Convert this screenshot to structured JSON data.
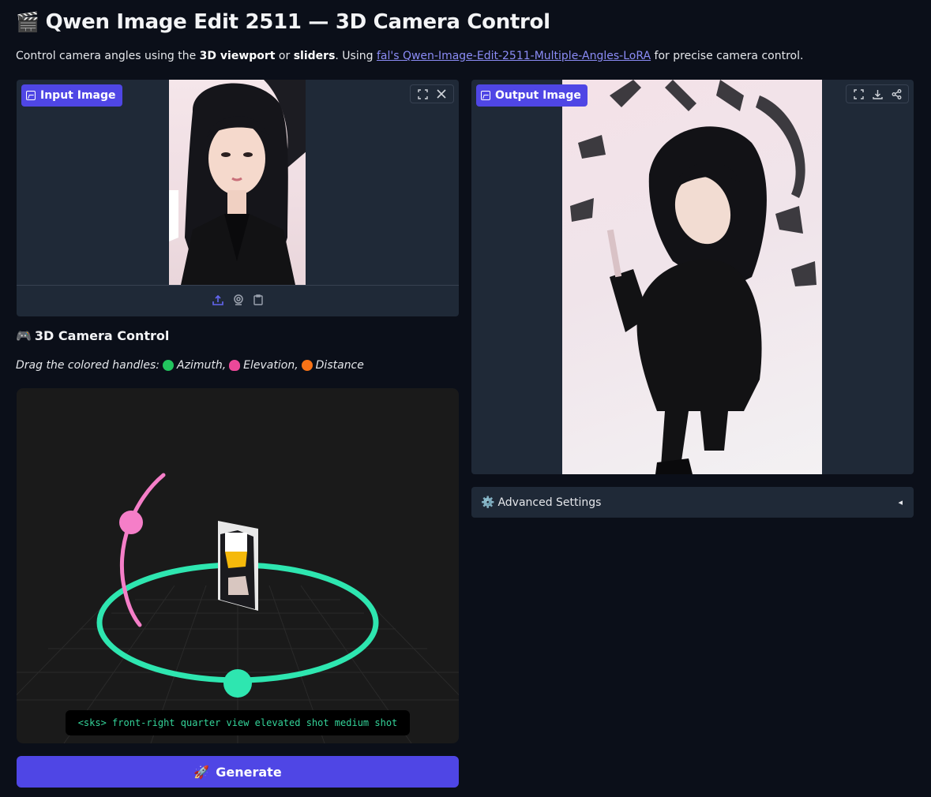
{
  "header": {
    "title_icon": "clapperboard-icon",
    "title_icon_glyph": "🎬",
    "title": "Qwen Image Edit 2511 — 3D Camera Control"
  },
  "description": {
    "prefix": "Control camera angles using the ",
    "bold1": "3D viewport",
    "mid1": " or ",
    "bold2": "sliders",
    "mid2": ". Using ",
    "link": "fal's Qwen-Image-Edit-2511-Multiple-Angles-LoRA",
    "suffix": " for precise camera control."
  },
  "input_panel": {
    "label": "Input Image",
    "tools": [
      "fullscreen-icon",
      "close-icon"
    ],
    "footer_tools": [
      "upload-icon",
      "webcam-icon",
      "clipboard-icon"
    ]
  },
  "output_panel": {
    "label": "Output Image",
    "tools": [
      "fullscreen-icon",
      "download-icon",
      "share-icon"
    ]
  },
  "camera_control": {
    "heading_icon": "🎮",
    "heading": "3D Camera Control",
    "hint_prefix": "Drag the colored handles:",
    "azimuth": "Azimuth,",
    "elevation": "Elevation,",
    "distance": "Distance",
    "colors": {
      "azimuth": "#22c55e",
      "elevation": "#ec4899",
      "distance": "#f97316",
      "ring": "#2ee6b0",
      "arc": "#f57ec8"
    },
    "prompt": "<sks> front-right quarter view elevated shot medium shot"
  },
  "generate_button": {
    "icon": "🚀",
    "label": "Generate"
  },
  "advanced_settings": {
    "icon": "⚙️",
    "label": "Advanced Settings",
    "chevron": "◂"
  }
}
